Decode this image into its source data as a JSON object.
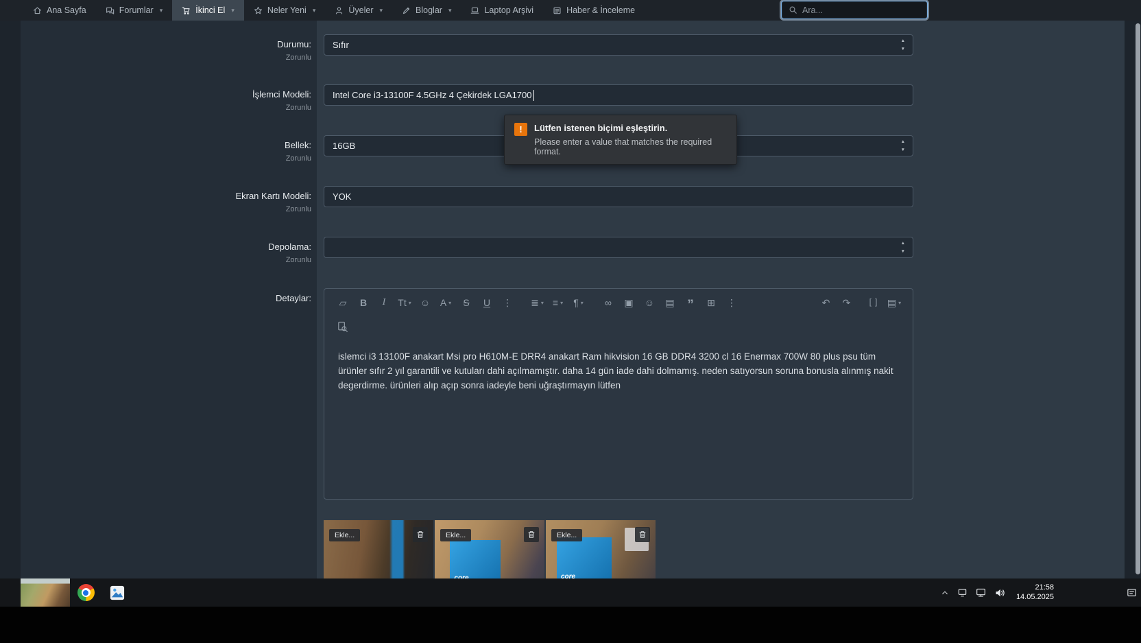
{
  "navbar": {
    "items": [
      {
        "label": "Ana Sayfa",
        "icon": "home-icon",
        "dropdown": false,
        "active": false
      },
      {
        "label": "Forumlar",
        "icon": "forums-icon",
        "dropdown": true,
        "active": false
      },
      {
        "label": "İkinci El",
        "icon": "cart-icon",
        "dropdown": true,
        "active": true
      },
      {
        "label": "Neler Yeni",
        "icon": "whats-new-icon",
        "dropdown": true,
        "active": false
      },
      {
        "label": "Üyeler",
        "icon": "members-icon",
        "dropdown": true,
        "active": false
      },
      {
        "label": "Bloglar",
        "icon": "blogs-icon",
        "dropdown": true,
        "active": false
      },
      {
        "label": "Laptop Arşivi",
        "icon": "laptop-icon",
        "dropdown": false,
        "active": false
      },
      {
        "label": "Haber & İnceleme",
        "icon": "news-icon",
        "dropdown": false,
        "active": false
      }
    ],
    "search_placeholder": "Ara..."
  },
  "form": {
    "required_label": "Zorunlu",
    "rows": {
      "durumu": {
        "label": "Durumu:",
        "value": "Sıfır",
        "control": "select"
      },
      "islemci": {
        "label": "İşlemci Modeli:",
        "value": "Intel Core i3-13100F 4.5GHz 4 Çekirdek LGA1700",
        "control": "text"
      },
      "bellek": {
        "label": "Bellek:",
        "value": "16GB",
        "control": "select"
      },
      "ekran": {
        "label": "Ekran Kartı Modeli:",
        "value": "YOK",
        "control": "text"
      },
      "depolama": {
        "label": "Depolama:",
        "value": "",
        "control": "select"
      },
      "detaylar": {
        "label": "Detaylar:",
        "control": "rich-text-editor"
      }
    }
  },
  "validation_tooltip": {
    "icon_glyph": "!",
    "title": "Lütfen istenen biçimi eşleştirin.",
    "message": "Please enter a value that matches the required format."
  },
  "editor": {
    "toolbar_left": [
      {
        "name": "remove-format-icon",
        "glyph": "▱"
      },
      {
        "name": "bold-icon",
        "glyph": "B"
      },
      {
        "name": "italic-icon",
        "glyph": "I"
      },
      {
        "name": "text-size-icon",
        "glyph": "Tt"
      },
      {
        "name": "smilie-icon",
        "glyph": "☺"
      },
      {
        "name": "text-color-icon",
        "glyph": "A"
      },
      {
        "name": "strikethrough-icon",
        "glyph": "S"
      },
      {
        "name": "underline-icon",
        "glyph": "U"
      },
      {
        "name": "more-text-options-icon",
        "glyph": "⋮"
      },
      {
        "name": "list-icon",
        "glyph": "≣"
      },
      {
        "name": "alignment-icon",
        "glyph": "≡"
      },
      {
        "name": "paragraph-format-icon",
        "glyph": "¶"
      },
      {
        "name": "insert-link-icon",
        "glyph": "∞"
      },
      {
        "name": "insert-image-icon",
        "glyph": "▣"
      },
      {
        "name": "emoji-icon",
        "glyph": "☺"
      },
      {
        "name": "media-icon",
        "glyph": "▤"
      },
      {
        "name": "quote-icon",
        "glyph": "”"
      },
      {
        "name": "table-icon",
        "glyph": "⊞"
      },
      {
        "name": "more-options-icon",
        "glyph": "⋮"
      }
    ],
    "toolbar_right": [
      {
        "name": "undo-icon",
        "glyph": "↶"
      },
      {
        "name": "redo-icon",
        "glyph": "↷"
      },
      {
        "name": "bbcode-icon",
        "glyph": "[ ]"
      },
      {
        "name": "drafts-icon",
        "glyph": "▤"
      }
    ],
    "content": "islemci i3 13100F anakart Msi pro H610M-E DRR4 anakart Ram hikvision 16 GB DDR4 3200 cl 16 Enermax 700W 80 plus psu tüm ürünler sıfır 2 yıl garantili ve kutuları dahi açılmamıştır. daha 14 gün iade dahi dolmamış. neden satıyorsun soruna bonusla alınmış nakit degerdirme. ürünleri alıp açıp sonra iadeyle beni uğraştırmayın lütfen"
  },
  "attachments": {
    "add_label": "Ekle...",
    "items": [
      {
        "box_label": ""
      },
      {
        "box_label": "core"
      },
      {
        "box_label": "core"
      }
    ]
  },
  "taskbar": {
    "apps": [
      "window-preview-thumbnail",
      "chrome-icon",
      "photos-app-icon"
    ],
    "tray_icons": [
      "chevron-up-icon",
      "display-icon",
      "network-icon",
      "volume-icon",
      "notification-icon"
    ],
    "time": "21:58",
    "date": "14.05.2025"
  }
}
